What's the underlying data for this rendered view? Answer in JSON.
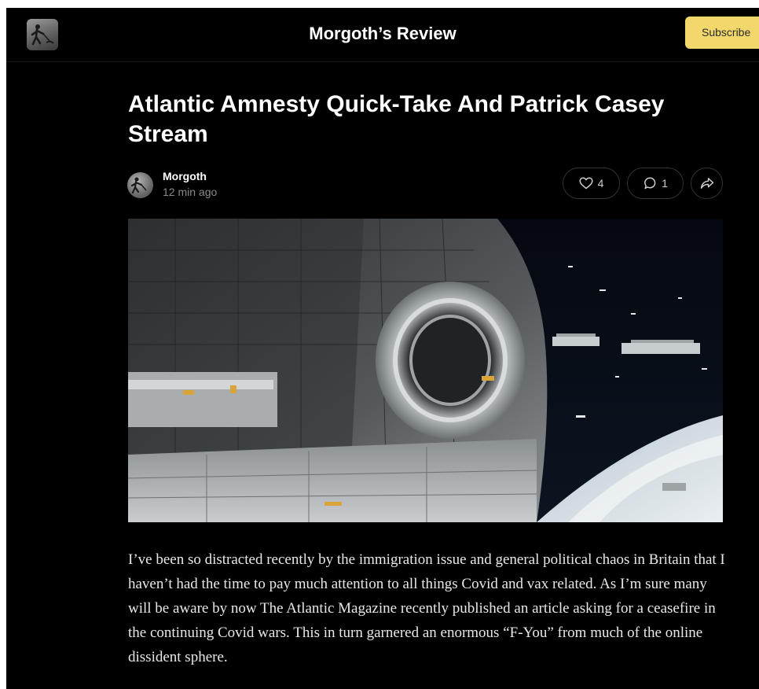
{
  "header": {
    "publication_name": "Morgoth’s Review",
    "subscribe_label": "Subscribe"
  },
  "post": {
    "title": "Atlantic Amnesty Quick-Take And Patrick Casey Stream",
    "author": "Morgoth",
    "published": "12 min ago",
    "likes": "4",
    "comments": "1",
    "body": "I’ve been so distracted recently by the immigration issue and general political chaos in Britain that I haven’t had the time to pay much attention to all things Covid and vax related. As I’m sure many will be aware by now The Atlantic Magazine recently published an article asking for a ceasefire in the continuing Covid wars. This in turn garnered an enormous “F-You” from much of the online dissident sphere."
  },
  "icons": {
    "like": "heart-icon",
    "comment": "comment-bubble-icon",
    "share": "share-arrow-icon"
  },
  "colors": {
    "background": "#000000",
    "subscribe_button": "#f2d86b",
    "text": "#ffffff",
    "muted_text": "#8a8a8a"
  }
}
